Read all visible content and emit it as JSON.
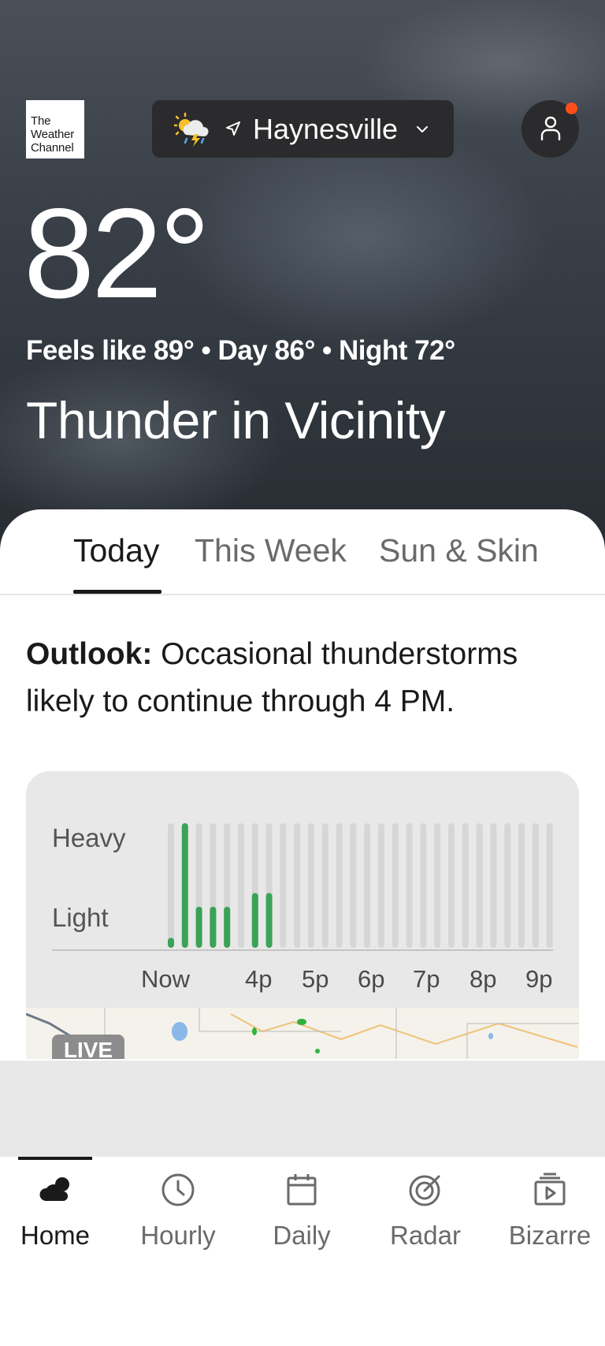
{
  "header": {
    "logo_lines": [
      "The",
      "Weather",
      "Channel"
    ],
    "location": "Haynesville",
    "weather_icon": "thunderstorm-sun-icon",
    "location_arrow_icon": "navigation-arrow-icon",
    "dropdown_icon": "chevron-down-icon",
    "profile_icon": "user-icon",
    "notification_color": "#ff4e17"
  },
  "current": {
    "temperature": "82°",
    "feels_line": "Feels like 89° • Day 86° • Night 72°",
    "condition": "Thunder in Vicinity"
  },
  "tabs": [
    {
      "label": "Today",
      "active": true
    },
    {
      "label": "This Week",
      "active": false
    },
    {
      "label": "Sun & Skin",
      "active": false
    }
  ],
  "outlook": {
    "label": "Outlook:",
    "text": "Occasional thunderstorms likely to continue through 4 PM."
  },
  "precip": {
    "y_labels": [
      "Heavy",
      "Light"
    ],
    "x_labels": [
      "Now",
      "4p",
      "5p",
      "6p",
      "7p",
      "8p",
      "9p"
    ],
    "intensity": [
      0.08,
      1.0,
      0.33,
      0.33,
      0.33,
      0,
      0.44,
      0.44,
      0,
      0,
      0,
      0,
      0,
      0,
      0,
      0,
      0,
      0,
      0,
      0,
      0,
      0,
      0,
      0,
      0,
      0,
      0,
      0
    ],
    "bar_color": "#3aa357",
    "track_color": "#d6d6d6",
    "map_badge": "LIVE"
  },
  "nav": [
    {
      "label": "Home",
      "icon": "cloud-icon",
      "active": true
    },
    {
      "label": "Hourly",
      "icon": "clock-icon",
      "active": false
    },
    {
      "label": "Daily",
      "icon": "calendar-icon",
      "active": false
    },
    {
      "label": "Radar",
      "icon": "radar-icon",
      "active": false
    },
    {
      "label": "Bizarre",
      "icon": "video-icon",
      "active": false
    }
  ]
}
